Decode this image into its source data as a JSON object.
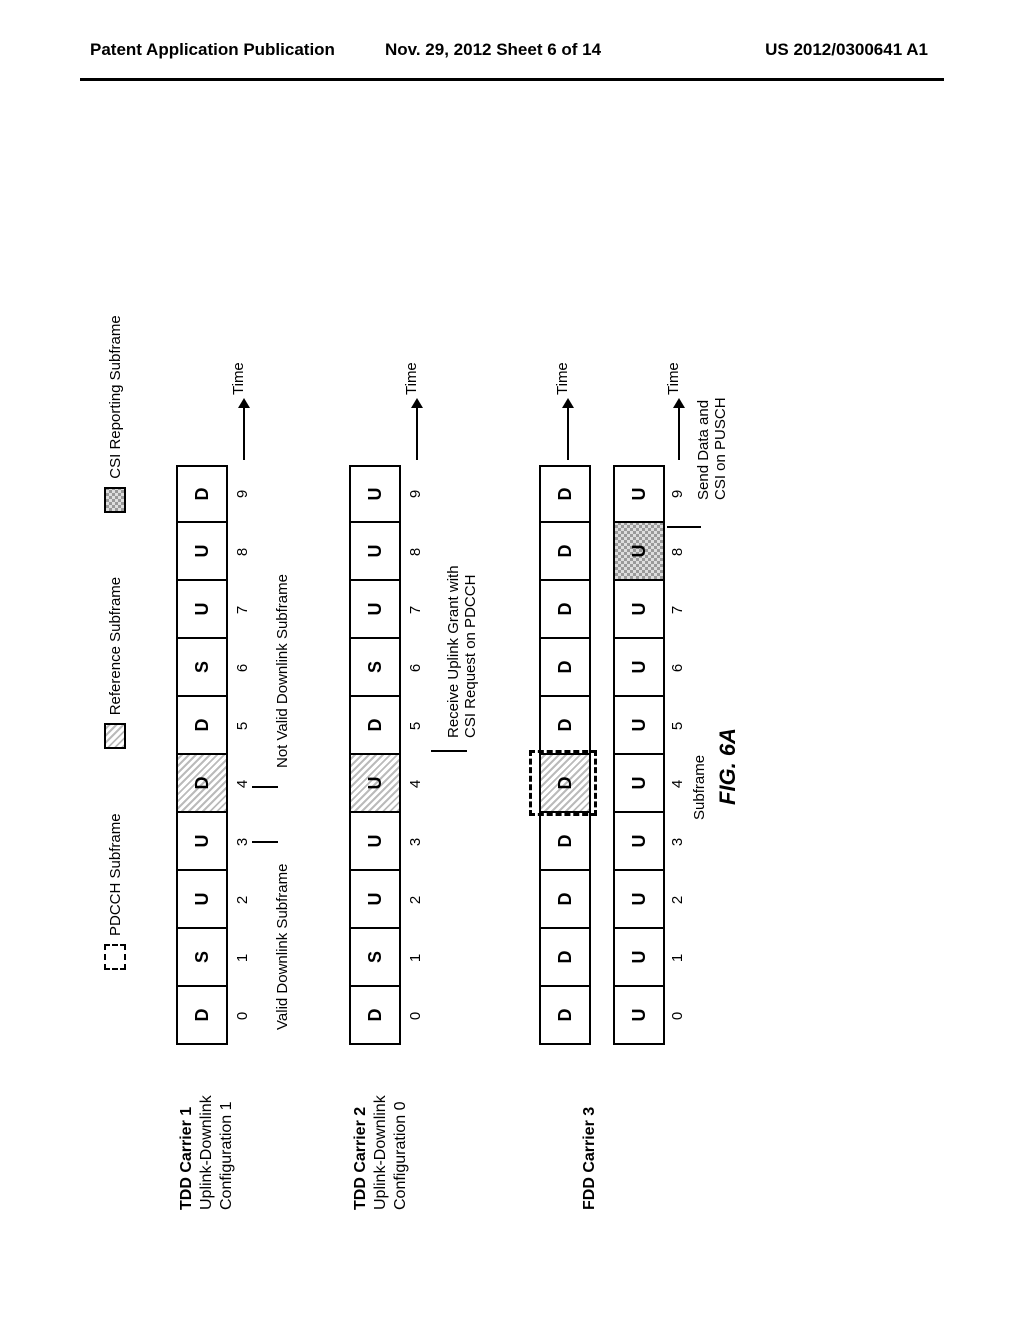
{
  "header": {
    "left": "Patent Application Publication",
    "center": "Nov. 29, 2012  Sheet 6 of 14",
    "right": "US 2012/0300641 A1"
  },
  "legend": {
    "pdcch": "PDCCH Subframe",
    "reference": "Reference Subframe",
    "csi": "CSI Reporting Subframe"
  },
  "carriers": {
    "c1": {
      "title": "TDD Carrier 1",
      "sub": "Uplink-Downlink\nConfiguration 1"
    },
    "c2": {
      "title": "TDD Carrier 2",
      "sub": "Uplink-Downlink\nConfiguration 0"
    },
    "c3": {
      "title": "FDD Carrier 3",
      "sub": ""
    }
  },
  "cells": {
    "row1": [
      "D",
      "S",
      "U",
      "U",
      "D",
      "D",
      "S",
      "U",
      "U",
      "D"
    ],
    "row2": [
      "D",
      "S",
      "U",
      "U",
      "U",
      "D",
      "S",
      "U",
      "U",
      "U"
    ],
    "row3dl": [
      "D",
      "D",
      "D",
      "D",
      "D",
      "D",
      "D",
      "D",
      "D",
      "D"
    ],
    "row3ul": [
      "U",
      "U",
      "U",
      "U",
      "U",
      "U",
      "U",
      "U",
      "U",
      "U"
    ]
  },
  "idx": [
    "0",
    "1",
    "2",
    "3",
    "4",
    "5",
    "6",
    "7",
    "8",
    "9"
  ],
  "labels": {
    "time": "Time",
    "valid": "Valid Downlink Subframe",
    "notvalid": "Not Valid Downlink Subframe",
    "ulgrant": "Receive Uplink Grant with\nCSI Request on PDCCH",
    "sendcsi": "Send Data and\nCSI on PUSCH",
    "subframe": "Subframe",
    "fig": "FIG. 6A"
  }
}
